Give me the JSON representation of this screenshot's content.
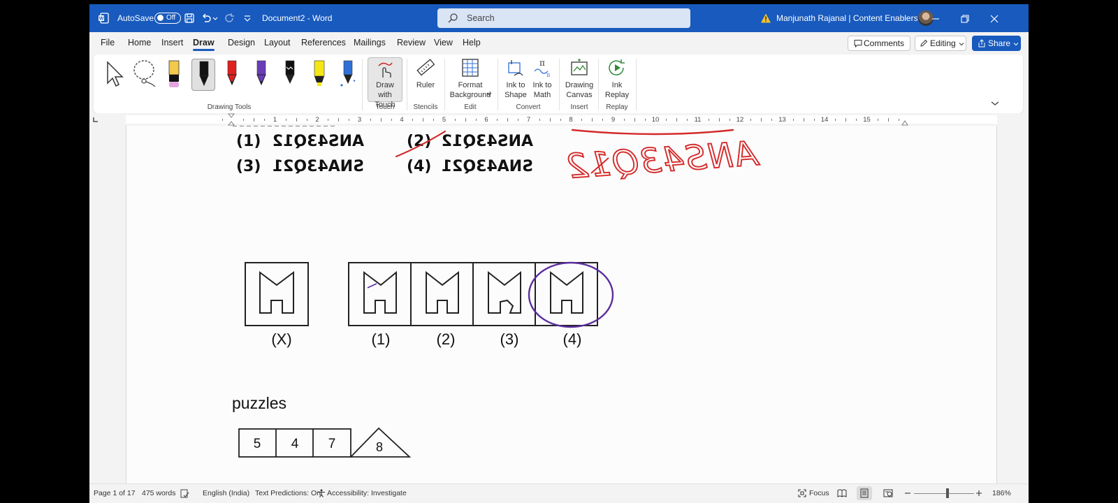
{
  "titlebar": {
    "autosave_label": "AutoSave",
    "autosave_state": "Off",
    "document_title": "Document2  -  Word",
    "search_placeholder": "Search",
    "user": "Manjunath Rajanal | Content Enablers"
  },
  "menu": {
    "items": [
      "File",
      "Home",
      "Insert",
      "Draw",
      "Design",
      "Layout",
      "References",
      "Mailings",
      "Review",
      "View",
      "Help"
    ],
    "active": "Draw",
    "comments_label": "Comments",
    "editing_label": "Editing",
    "share_label": "Share"
  },
  "ribbon": {
    "drawing_tools_label": "Drawing Tools",
    "touch": {
      "button": "Draw with Touch",
      "group": "Touch"
    },
    "stencils": {
      "button": "Ruler",
      "group": "Stencils"
    },
    "edit": {
      "button": "Format Background",
      "group": "Edit"
    },
    "convert": {
      "button1": "Ink to Shape",
      "button2": "Ink to Math",
      "group": "Convert"
    },
    "insert": {
      "button": "Drawing Canvas",
      "group": "Insert"
    },
    "replay": {
      "button": "Ink Replay",
      "group": "Replay"
    },
    "pen_colors": [
      "#f2c94c",
      "#111111",
      "#e02020",
      "#6a3db8",
      "#111111",
      "#f5e614",
      "#2f6fd6"
    ]
  },
  "ruler": {
    "numbers": [
      "1",
      "2",
      "3",
      "4",
      "5",
      "6",
      "7",
      "8",
      "9",
      "10",
      "11",
      "12",
      "13",
      "14",
      "15"
    ]
  },
  "document": {
    "options": [
      {
        "num": "(1)",
        "text": "ANS43Q12"
      },
      {
        "num": "(2)",
        "text": "ANS43Q12"
      },
      {
        "num": "(3)",
        "text": "SNA43Q21"
      },
      {
        "num": "(4)",
        "text": "SNA43Q21"
      }
    ],
    "handwritten_answer": "ANS43Q12",
    "figure_labels": [
      "(X)",
      "(1)",
      "(2)",
      "(3)",
      "(4)"
    ],
    "heading": "puzzles",
    "puzzle_numbers": [
      "5",
      "4",
      "7",
      "8"
    ],
    "ink_colors": {
      "red": "#d42a2a",
      "purple": "#5b2d9c"
    }
  },
  "status": {
    "page": "Page 1 of 17",
    "words": "475 words",
    "language": "English (India)",
    "text_predictions": "Text Predictions: On",
    "accessibility": "Accessibility: Investigate",
    "focus": "Focus",
    "zoom": "186%"
  }
}
